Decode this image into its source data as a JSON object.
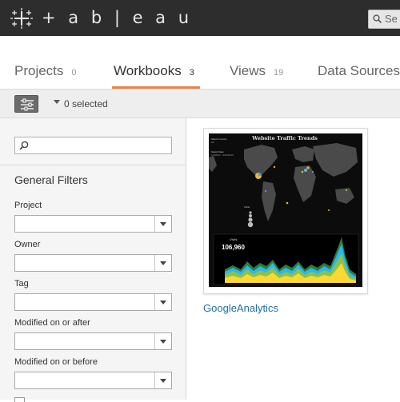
{
  "header": {
    "brand": "+ a b | e a u",
    "search_text": "Se"
  },
  "tabs": [
    {
      "label": "Projects",
      "count": "0",
      "active": false
    },
    {
      "label": "Workbooks",
      "count": "3",
      "active": true
    },
    {
      "label": "Views",
      "count": "19",
      "active": false
    },
    {
      "label": "Data Sources",
      "count": "",
      "active": false
    }
  ],
  "toolbar": {
    "selected_text": "0 selected"
  },
  "sidebar": {
    "search_value": "",
    "section_title": "General Filters",
    "filters": [
      {
        "label": "Project",
        "value": ""
      },
      {
        "label": "Owner",
        "value": ""
      },
      {
        "label": "Tag",
        "value": ""
      },
      {
        "label": "Modified on or after",
        "value": ""
      },
      {
        "label": "Modified on or before",
        "value": ""
      }
    ]
  },
  "workbooks": [
    {
      "name": "GoogleAnalytics",
      "thumbnail": {
        "title": "Website Traffic Trends",
        "select_country_label": "Select Country",
        "select_country_value": "All",
        "select_date_label": "Select Date",
        "select_date_value": "1/1/2012 - 3/31/2013",
        "visits_label": "Visits",
        "visits_value": "106,960"
      }
    }
  ],
  "colors": {
    "accent_underline": "#e9834a",
    "link": "#1f6fa8",
    "topbar": "#2d2d2d"
  }
}
